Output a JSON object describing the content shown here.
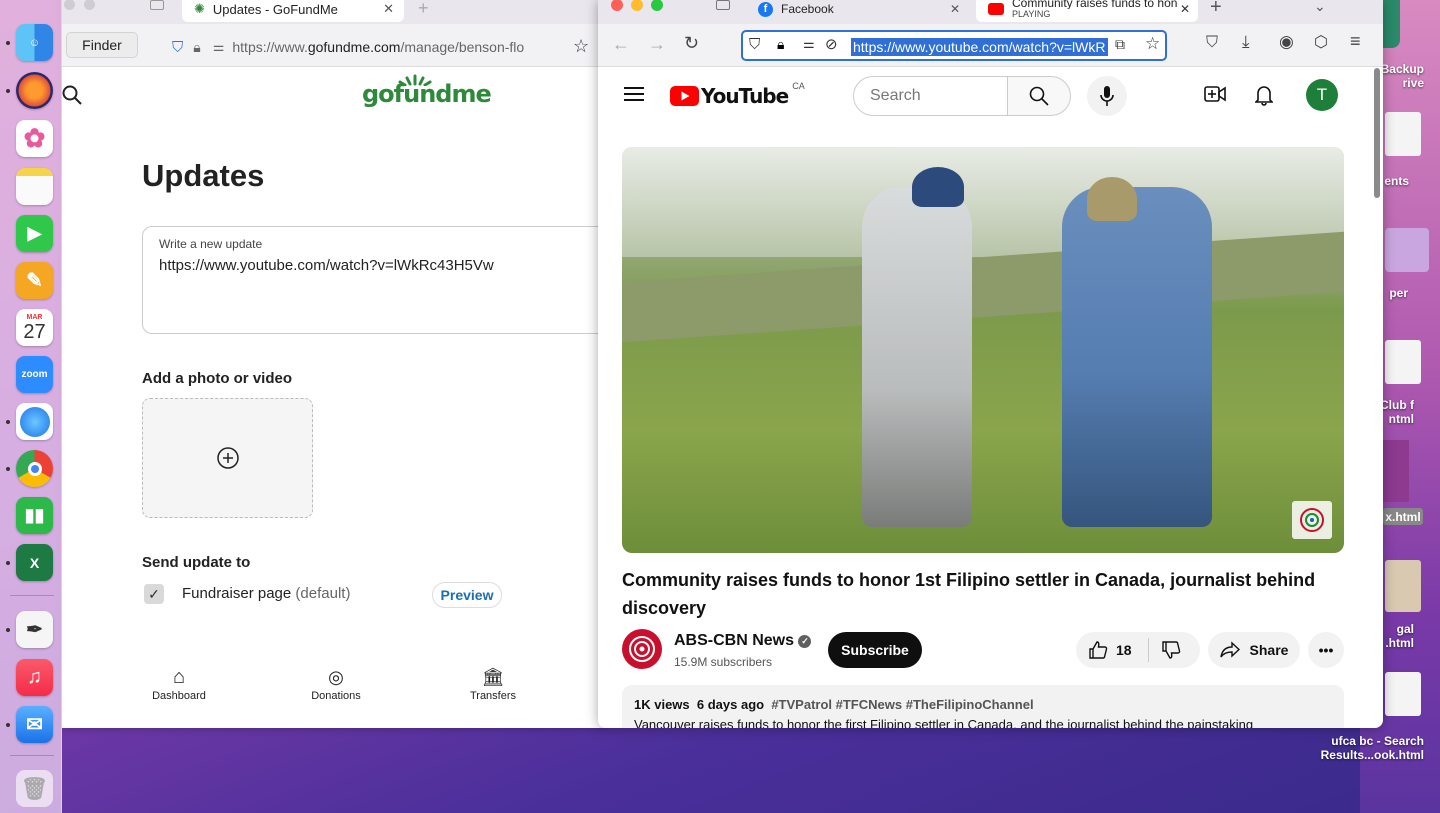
{
  "desktop": {
    "labels": [
      "Backup",
      "rive",
      "ents",
      "per",
      "Club f",
      "ntml",
      "x.html",
      "gal",
      ".html"
    ],
    "search_result_title": "ufca bc - Search",
    "search_result_sub": "Results...ook.html"
  },
  "dock": {
    "calendar_month": "MAR",
    "calendar_day": "27",
    "zoom_label": "zoom"
  },
  "left_window": {
    "tab_title": "Updates - GoFundMe",
    "finder_tooltip": "Finder",
    "url_prefix": "https://www.",
    "url_domain": "gofundme.com",
    "url_rest": "/manage/benson-flo",
    "logo": "gofundme",
    "page_title": "Updates",
    "update_label": "Write a new update",
    "update_value": "https://www.youtube.com/watch?v=lWkRc43H5Vw",
    "photo_heading": "Add a photo or video",
    "send_heading": "Send update to",
    "recipient": "Fundraiser page",
    "recipient_note": "(default)",
    "preview": "Preview",
    "bottom_nav": [
      "Dashboard",
      "Donations",
      "Transfers"
    ]
  },
  "right_window": {
    "tabs": [
      {
        "title": "Facebook"
      },
      {
        "title": "Community raises funds to honc",
        "sub": "PLAYING"
      }
    ],
    "url": "https://www.youtube.com/watch?v=lWkR",
    "yt_logo": "YouTube",
    "yt_country": "CA",
    "search_placeholder": "Search",
    "avatar_initial": "T",
    "video_title": "Community raises funds to honor 1st Filipino settler in Canada, journalist behind discovery",
    "channel_name": "ABS-CBN News",
    "channel_subs": "15.9M subscribers",
    "subscribe": "Subscribe",
    "likes": "18",
    "share": "Share",
    "views": "1K views",
    "age": "6 days ago",
    "hashtags": [
      "#TVPatrol",
      "#TFCNews",
      "#TheFilipinoChannel"
    ],
    "desc_text": "Vancouver raises funds to honor the first Filipino settler in Canada, and the journalist behind the painstaking"
  },
  "colors": {
    "youtube_red": "#ff0000",
    "gofundme_green": "#2e8a3b",
    "url_focus": "#2f6fd6"
  }
}
